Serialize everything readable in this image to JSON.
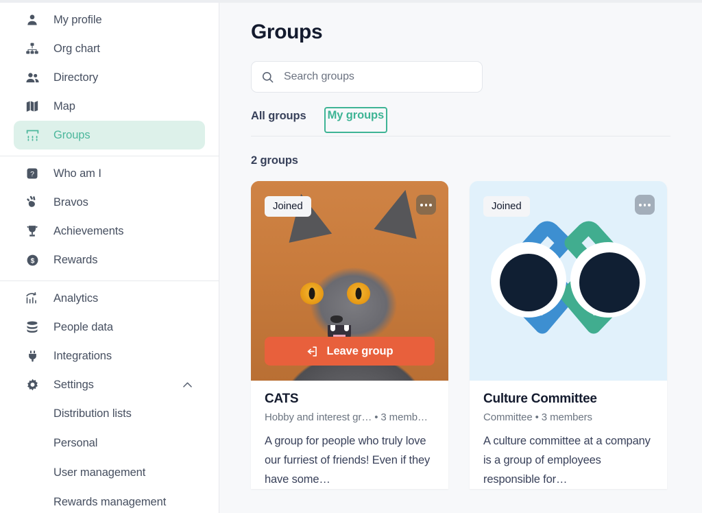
{
  "sidebar": {
    "groups": [
      {
        "items": [
          {
            "label": "My profile",
            "icon": "person-icon",
            "active": false
          },
          {
            "label": "Org chart",
            "icon": "org-chart-icon",
            "active": false
          },
          {
            "label": "Directory",
            "icon": "people-icon",
            "active": false
          },
          {
            "label": "Map",
            "icon": "map-icon",
            "active": false
          },
          {
            "label": "Groups",
            "icon": "groups-icon",
            "active": true
          }
        ]
      },
      {
        "items": [
          {
            "label": "Who am I",
            "icon": "question-badge-icon",
            "active": false
          },
          {
            "label": "Bravos",
            "icon": "clap-icon",
            "active": false
          },
          {
            "label": "Achievements",
            "icon": "trophy-icon",
            "active": false
          },
          {
            "label": "Rewards",
            "icon": "dollar-coin-icon",
            "active": false
          }
        ]
      },
      {
        "items": [
          {
            "label": "Analytics",
            "icon": "analytics-chart-icon",
            "active": false
          },
          {
            "label": "People data",
            "icon": "database-icon",
            "active": false
          },
          {
            "label": "Integrations",
            "icon": "plug-icon",
            "active": false
          },
          {
            "label": "Settings",
            "icon": "gear-icon",
            "active": false,
            "expanded": true,
            "chevron": "chevron-up-icon"
          }
        ],
        "subitems": [
          {
            "label": "Distribution lists"
          },
          {
            "label": "Personal"
          },
          {
            "label": "User management"
          },
          {
            "label": "Rewards management"
          }
        ]
      }
    ]
  },
  "main": {
    "page_title": "Groups",
    "search": {
      "placeholder": "Search groups",
      "value": "",
      "icon": "search-icon"
    },
    "tabs": [
      {
        "label": "All groups",
        "selected": false,
        "focused": false
      },
      {
        "label": "My groups",
        "selected": true,
        "focused": true
      }
    ],
    "result_count_label": "2 groups",
    "cards": [
      {
        "badge": "Joined",
        "menu_icon": "ellipsis-icon",
        "action_label": "Leave group",
        "action_icon": "leave-arrow-icon",
        "action_color": "#e8603c",
        "title": "CATS",
        "category": "Hobby and interest gr…",
        "separator": "•",
        "members": "3 memb…",
        "description": "A group for people who truly love our furriest of friends! Even if they have some…",
        "media": "cat-photo"
      },
      {
        "badge": "Joined",
        "menu_icon": "ellipsis-icon",
        "action_label": "",
        "action_icon": "",
        "action_color": "",
        "title": "Culture Committee",
        "category": "Committee",
        "separator": "•",
        "members": "3 members",
        "description": "A culture committee at a company is a group of employees responsible for…",
        "media": "culture-logo"
      }
    ]
  },
  "colors": {
    "accent_teal": "#3eb495",
    "active_nav_bg": "#ddf1ea",
    "active_nav_text": "#4cb79c",
    "leave_button": "#e8603c",
    "page_bg": "#f7f8fa",
    "sidebar_bg": "#ffffff",
    "text_dark": "#141b2e",
    "text_muted": "#6b7480",
    "logo_blue": "#3d8fd1",
    "logo_green": "#41ad8f",
    "culture_bg": "#e1f1fb",
    "cats_bg": "#c97a3e"
  }
}
